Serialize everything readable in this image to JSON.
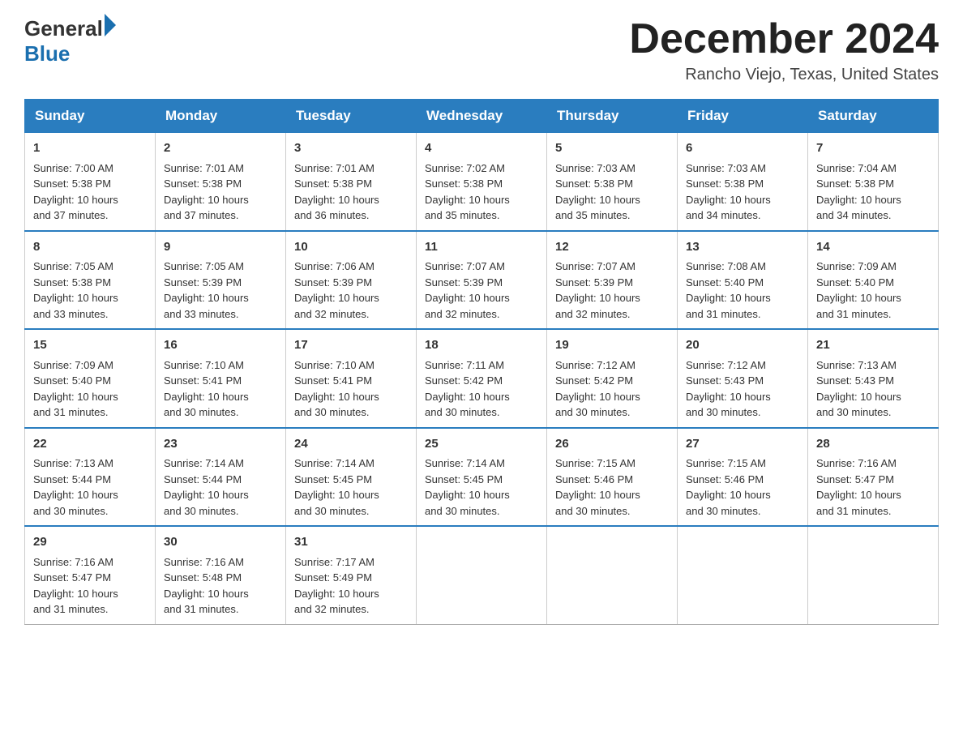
{
  "header": {
    "logo_general": "General",
    "logo_blue": "Blue",
    "month_title": "December 2024",
    "location": "Rancho Viejo, Texas, United States"
  },
  "weekdays": [
    "Sunday",
    "Monday",
    "Tuesday",
    "Wednesday",
    "Thursday",
    "Friday",
    "Saturday"
  ],
  "weeks": [
    [
      {
        "day": "1",
        "info": "Sunrise: 7:00 AM\nSunset: 5:38 PM\nDaylight: 10 hours\nand 37 minutes."
      },
      {
        "day": "2",
        "info": "Sunrise: 7:01 AM\nSunset: 5:38 PM\nDaylight: 10 hours\nand 37 minutes."
      },
      {
        "day": "3",
        "info": "Sunrise: 7:01 AM\nSunset: 5:38 PM\nDaylight: 10 hours\nand 36 minutes."
      },
      {
        "day": "4",
        "info": "Sunrise: 7:02 AM\nSunset: 5:38 PM\nDaylight: 10 hours\nand 35 minutes."
      },
      {
        "day": "5",
        "info": "Sunrise: 7:03 AM\nSunset: 5:38 PM\nDaylight: 10 hours\nand 35 minutes."
      },
      {
        "day": "6",
        "info": "Sunrise: 7:03 AM\nSunset: 5:38 PM\nDaylight: 10 hours\nand 34 minutes."
      },
      {
        "day": "7",
        "info": "Sunrise: 7:04 AM\nSunset: 5:38 PM\nDaylight: 10 hours\nand 34 minutes."
      }
    ],
    [
      {
        "day": "8",
        "info": "Sunrise: 7:05 AM\nSunset: 5:38 PM\nDaylight: 10 hours\nand 33 minutes."
      },
      {
        "day": "9",
        "info": "Sunrise: 7:05 AM\nSunset: 5:39 PM\nDaylight: 10 hours\nand 33 minutes."
      },
      {
        "day": "10",
        "info": "Sunrise: 7:06 AM\nSunset: 5:39 PM\nDaylight: 10 hours\nand 32 minutes."
      },
      {
        "day": "11",
        "info": "Sunrise: 7:07 AM\nSunset: 5:39 PM\nDaylight: 10 hours\nand 32 minutes."
      },
      {
        "day": "12",
        "info": "Sunrise: 7:07 AM\nSunset: 5:39 PM\nDaylight: 10 hours\nand 32 minutes."
      },
      {
        "day": "13",
        "info": "Sunrise: 7:08 AM\nSunset: 5:40 PM\nDaylight: 10 hours\nand 31 minutes."
      },
      {
        "day": "14",
        "info": "Sunrise: 7:09 AM\nSunset: 5:40 PM\nDaylight: 10 hours\nand 31 minutes."
      }
    ],
    [
      {
        "day": "15",
        "info": "Sunrise: 7:09 AM\nSunset: 5:40 PM\nDaylight: 10 hours\nand 31 minutes."
      },
      {
        "day": "16",
        "info": "Sunrise: 7:10 AM\nSunset: 5:41 PM\nDaylight: 10 hours\nand 30 minutes."
      },
      {
        "day": "17",
        "info": "Sunrise: 7:10 AM\nSunset: 5:41 PM\nDaylight: 10 hours\nand 30 minutes."
      },
      {
        "day": "18",
        "info": "Sunrise: 7:11 AM\nSunset: 5:42 PM\nDaylight: 10 hours\nand 30 minutes."
      },
      {
        "day": "19",
        "info": "Sunrise: 7:12 AM\nSunset: 5:42 PM\nDaylight: 10 hours\nand 30 minutes."
      },
      {
        "day": "20",
        "info": "Sunrise: 7:12 AM\nSunset: 5:43 PM\nDaylight: 10 hours\nand 30 minutes."
      },
      {
        "day": "21",
        "info": "Sunrise: 7:13 AM\nSunset: 5:43 PM\nDaylight: 10 hours\nand 30 minutes."
      }
    ],
    [
      {
        "day": "22",
        "info": "Sunrise: 7:13 AM\nSunset: 5:44 PM\nDaylight: 10 hours\nand 30 minutes."
      },
      {
        "day": "23",
        "info": "Sunrise: 7:14 AM\nSunset: 5:44 PM\nDaylight: 10 hours\nand 30 minutes."
      },
      {
        "day": "24",
        "info": "Sunrise: 7:14 AM\nSunset: 5:45 PM\nDaylight: 10 hours\nand 30 minutes."
      },
      {
        "day": "25",
        "info": "Sunrise: 7:14 AM\nSunset: 5:45 PM\nDaylight: 10 hours\nand 30 minutes."
      },
      {
        "day": "26",
        "info": "Sunrise: 7:15 AM\nSunset: 5:46 PM\nDaylight: 10 hours\nand 30 minutes."
      },
      {
        "day": "27",
        "info": "Sunrise: 7:15 AM\nSunset: 5:46 PM\nDaylight: 10 hours\nand 30 minutes."
      },
      {
        "day": "28",
        "info": "Sunrise: 7:16 AM\nSunset: 5:47 PM\nDaylight: 10 hours\nand 31 minutes."
      }
    ],
    [
      {
        "day": "29",
        "info": "Sunrise: 7:16 AM\nSunset: 5:47 PM\nDaylight: 10 hours\nand 31 minutes."
      },
      {
        "day": "30",
        "info": "Sunrise: 7:16 AM\nSunset: 5:48 PM\nDaylight: 10 hours\nand 31 minutes."
      },
      {
        "day": "31",
        "info": "Sunrise: 7:17 AM\nSunset: 5:49 PM\nDaylight: 10 hours\nand 32 minutes."
      },
      {
        "day": "",
        "info": ""
      },
      {
        "day": "",
        "info": ""
      },
      {
        "day": "",
        "info": ""
      },
      {
        "day": "",
        "info": ""
      }
    ]
  ]
}
